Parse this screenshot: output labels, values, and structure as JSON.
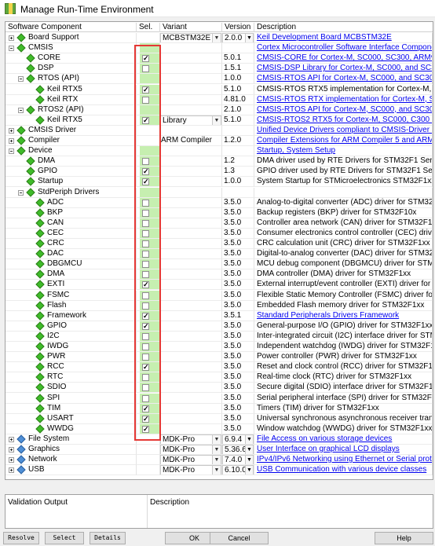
{
  "window": {
    "title": "Manage Run-Time Environment"
  },
  "columns": {
    "component": "Software Component",
    "sel": "Sel.",
    "variant": "Variant",
    "version": "Version",
    "description": "Description"
  },
  "rows": [
    {
      "level": 0,
      "exp": "plus",
      "name": "Board Support",
      "gem": "green",
      "sel": "none",
      "variant": "MCBSTM32E",
      "variantCombo": true,
      "version": "2.0.0",
      "verCombo": true,
      "desc": "Keil Development Board MCBSTM32E",
      "link": true
    },
    {
      "level": 0,
      "exp": "minus",
      "name": "CMSIS",
      "gem": "green",
      "sel": "green",
      "variant": "",
      "version": "",
      "desc": "Cortex Microcontroller Software Interface Components",
      "link": true
    },
    {
      "level": 1,
      "name": "CORE",
      "gem": "green",
      "sel": "checked",
      "variant": "",
      "version": "5.0.1",
      "desc": "CMSIS-CORE for Cortex-M, SC000, SC300, ARMv8-M",
      "link": true
    },
    {
      "level": 1,
      "name": "DSP",
      "gem": "green",
      "sel": "unchecked",
      "variant": "",
      "version": "1.5.1",
      "desc": "CMSIS-DSP Library for Cortex-M, SC000, and SC300",
      "link": true
    },
    {
      "level": 1,
      "exp": "minus",
      "name": "RTOS (API)",
      "gem": "green",
      "sel": "green",
      "variant": "",
      "version": "1.0.0",
      "desc": "CMSIS-RTOS API for Cortex-M, SC000, and SC300",
      "link": true
    },
    {
      "level": 2,
      "name": "Keil RTX5",
      "gem": "green",
      "sel": "checked",
      "variant": "",
      "version": "5.1.0",
      "desc": "CMSIS-RTOS RTX5 implementation for Cortex-M, SC000, and SC300",
      "link": false
    },
    {
      "level": 2,
      "name": "Keil RTX",
      "gem": "green",
      "sel": "unchecked",
      "variant": "",
      "version": "4.81.0",
      "desc": "CMSIS-RTOS RTX implementation for Cortex-M, SC000, and SC300",
      "link": true
    },
    {
      "level": 1,
      "exp": "minus",
      "name": "RTOS2 (API)",
      "gem": "green",
      "sel": "green",
      "variant": "",
      "version": "2.1.0",
      "desc": "CMSIS-RTOS API for Cortex-M, SC000, and SC300",
      "link": true
    },
    {
      "level": 2,
      "name": "Keil RTX5",
      "gem": "green",
      "sel": "checked",
      "variant": "Library",
      "variantCombo": true,
      "version": "5.1.0",
      "desc": "CMSIS-RTOS2 RTX5 for Cortex-M, SC000, C300 and ARMv8-M (Library)",
      "link": true
    },
    {
      "level": 0,
      "exp": "plus",
      "name": "CMSIS Driver",
      "gem": "green",
      "sel": "none",
      "variant": "",
      "version": "",
      "desc": "Unified Device Drivers compliant to CMSIS-Driver Specifications",
      "link": true
    },
    {
      "level": 0,
      "exp": "plus",
      "name": "Compiler",
      "gem": "green",
      "sel": "none",
      "variant": "ARM Compiler",
      "version": "1.2.0",
      "desc": "Compiler Extensions for ARM Compiler 5 and ARM Compiler 6",
      "link": true
    },
    {
      "level": 0,
      "exp": "minus",
      "name": "Device",
      "gem": "green",
      "sel": "green",
      "variant": "",
      "version": "",
      "desc": "Startup, System Setup",
      "link": true
    },
    {
      "level": 1,
      "name": "DMA",
      "gem": "green",
      "sel": "unchecked",
      "variant": "",
      "version": "1.2",
      "desc": "DMA driver used by RTE Drivers for STM32F1 Series",
      "link": false
    },
    {
      "level": 1,
      "name": "GPIO",
      "gem": "green",
      "sel": "checked",
      "variant": "",
      "version": "1.3",
      "desc": "GPIO driver used by RTE Drivers for STM32F1 Series",
      "link": false
    },
    {
      "level": 1,
      "name": "Startup",
      "gem": "green",
      "sel": "checked",
      "variant": "",
      "version": "1.0.0",
      "desc": "System Startup for STMicroelectronics STM32F1xx device series",
      "link": false
    },
    {
      "level": 1,
      "exp": "minus",
      "name": "StdPeriph Drivers",
      "gem": "green",
      "sel": "green",
      "variant": "",
      "version": "",
      "desc": "",
      "link": false
    },
    {
      "level": 2,
      "name": "ADC",
      "gem": "green",
      "sel": "unchecked",
      "variant": "",
      "version": "3.5.0",
      "desc": "Analog-to-digital converter (ADC) driver for STM32F10x",
      "link": false
    },
    {
      "level": 2,
      "name": "BKP",
      "gem": "green",
      "sel": "unchecked",
      "variant": "",
      "version": "3.5.0",
      "desc": "Backup registers (BKP) driver for STM32F10x",
      "link": false
    },
    {
      "level": 2,
      "name": "CAN",
      "gem": "green",
      "sel": "unchecked",
      "variant": "",
      "version": "3.5.0",
      "desc": "Controller area network (CAN) driver for STM32F1xx",
      "link": false
    },
    {
      "level": 2,
      "name": "CEC",
      "gem": "green",
      "sel": "unchecked",
      "variant": "",
      "version": "3.5.0",
      "desc": "Consumer electronics control controller (CEC) driver for STM32F1xx",
      "link": false
    },
    {
      "level": 2,
      "name": "CRC",
      "gem": "green",
      "sel": "unchecked",
      "variant": "",
      "version": "3.5.0",
      "desc": "CRC calculation unit (CRC) driver for STM32F1xx",
      "link": false
    },
    {
      "level": 2,
      "name": "DAC",
      "gem": "green",
      "sel": "unchecked",
      "variant": "",
      "version": "3.5.0",
      "desc": "Digital-to-analog converter (DAC) driver for STM32F1xx",
      "link": false
    },
    {
      "level": 2,
      "name": "DBGMCU",
      "gem": "green",
      "sel": "unchecked",
      "variant": "",
      "version": "3.5.0",
      "desc": "MCU debug component (DBGMCU) driver for STM32F1xx",
      "link": false
    },
    {
      "level": 2,
      "name": "DMA",
      "gem": "green",
      "sel": "unchecked",
      "variant": "",
      "version": "3.5.0",
      "desc": "DMA controller (DMA) driver for STM32F1xx",
      "link": false
    },
    {
      "level": 2,
      "name": "EXTI",
      "gem": "green",
      "sel": "checked",
      "variant": "",
      "version": "3.5.0",
      "desc": "External interrupt/event controller (EXTI) driver for STM32F1xx",
      "link": false
    },
    {
      "level": 2,
      "name": "FSMC",
      "gem": "green",
      "sel": "unchecked",
      "variant": "",
      "version": "3.5.0",
      "desc": "Flexible Static Memory Controller (FSMC) driver for STM32F11x",
      "link": false
    },
    {
      "level": 2,
      "name": "Flash",
      "gem": "green",
      "sel": "unchecked",
      "variant": "",
      "version": "3.5.0",
      "desc": "Embedded Flash memory driver for STM32F1xx",
      "link": false
    },
    {
      "level": 2,
      "name": "Framework",
      "gem": "green",
      "sel": "checked",
      "variant": "",
      "version": "3.5.1",
      "desc": "Standard Peripherals Drivers Framework",
      "link": true
    },
    {
      "level": 2,
      "name": "GPIO",
      "gem": "green",
      "sel": "checked",
      "variant": "",
      "version": "3.5.0",
      "desc": "General-purpose I/O (GPIO) driver for STM32F1xx",
      "link": false
    },
    {
      "level": 2,
      "name": "I2C",
      "gem": "green",
      "sel": "unchecked",
      "variant": "",
      "version": "3.5.0",
      "desc": "Inter-integrated circuit (I2C) interface driver for STM32F1xx",
      "link": false
    },
    {
      "level": 2,
      "name": "IWDG",
      "gem": "green",
      "sel": "unchecked",
      "variant": "",
      "version": "3.5.0",
      "desc": "Independent watchdog (IWDG) driver for STM32F1xx",
      "link": false
    },
    {
      "level": 2,
      "name": "PWR",
      "gem": "green",
      "sel": "unchecked",
      "variant": "",
      "version": "3.5.0",
      "desc": "Power controller (PWR) driver for STM32F1xx",
      "link": false
    },
    {
      "level": 2,
      "name": "RCC",
      "gem": "green",
      "sel": "checked",
      "variant": "",
      "version": "3.5.0",
      "desc": "Reset and clock control (RCC) driver for STM32F1xx",
      "link": false
    },
    {
      "level": 2,
      "name": "RTC",
      "gem": "green",
      "sel": "unchecked",
      "variant": "",
      "version": "3.5.0",
      "desc": "Real-time clock (RTC) driver for STM32F1xx",
      "link": false
    },
    {
      "level": 2,
      "name": "SDIO",
      "gem": "green",
      "sel": "unchecked",
      "variant": "",
      "version": "3.5.0",
      "desc": "Secure digital (SDIO) interface driver for STM32F1xx",
      "link": false
    },
    {
      "level": 2,
      "name": "SPI",
      "gem": "green",
      "sel": "unchecked",
      "variant": "",
      "version": "3.5.0",
      "desc": "Serial peripheral interface (SPI) driver for STM32F1xx",
      "link": false
    },
    {
      "level": 2,
      "name": "TIM",
      "gem": "green",
      "sel": "checked",
      "variant": "",
      "version": "3.5.0",
      "desc": "Timers (TIM) driver for STM32F1xx",
      "link": false
    },
    {
      "level": 2,
      "name": "USART",
      "gem": "green",
      "sel": "checked",
      "variant": "",
      "version": "3.5.0",
      "desc": "Universal synchronous asynchronous receiver transmitter (USART)",
      "link": false
    },
    {
      "level": 2,
      "name": "WWDG",
      "gem": "green",
      "sel": "checked",
      "variant": "",
      "version": "3.5.0",
      "desc": "Window watchdog (WWDG) driver for STM32F1xx",
      "link": false
    },
    {
      "level": 0,
      "exp": "plus",
      "name": "File System",
      "gem": "blue",
      "sel": "none",
      "variant": "MDK-Pro",
      "variantCombo": true,
      "version": "6.9.4",
      "verCombo": true,
      "desc": "File Access on various storage devices",
      "link": true
    },
    {
      "level": 0,
      "exp": "plus",
      "name": "Graphics",
      "gem": "blue",
      "sel": "none",
      "variant": "MDK-Pro",
      "variantCombo": true,
      "version": "5.36.6",
      "verCombo": true,
      "desc": "User Interface on graphical LCD displays",
      "link": true
    },
    {
      "level": 0,
      "exp": "plus",
      "name": "Network",
      "gem": "blue",
      "sel": "none",
      "variant": "MDK-Pro",
      "variantCombo": true,
      "version": "7.4.0",
      "verCombo": true,
      "desc": "IPv4/IPv6 Networking using Ethernet or Serial protocols",
      "link": true
    },
    {
      "level": 0,
      "exp": "plus",
      "name": "USB",
      "gem": "blue",
      "sel": "none",
      "variant": "MDK-Pro",
      "variantCombo": true,
      "version": "6.10.0",
      "verCombo": true,
      "desc": "USB Communication with various device classes",
      "link": true
    }
  ],
  "validation": {
    "output_label": "Validation Output",
    "description_label": "Description"
  },
  "buttons": {
    "resolve": "Resolve",
    "select_p": "Select P...",
    "details": "Details",
    "ok": "OK",
    "cancel": "Cancel",
    "help": "Help"
  }
}
